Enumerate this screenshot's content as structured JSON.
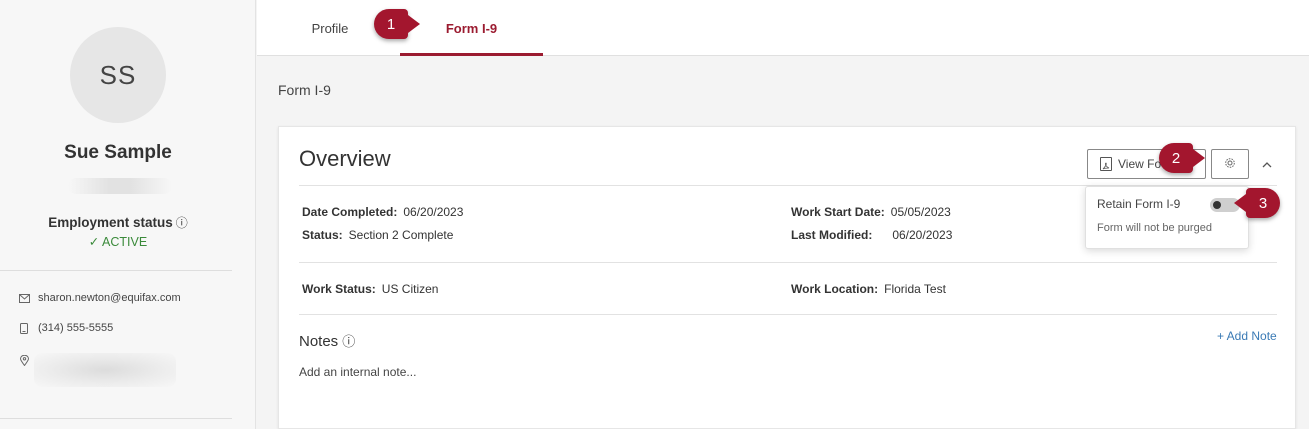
{
  "sidebar": {
    "avatar_initials": "SS",
    "name": "Sue Sample",
    "employment_status_label": "Employment status",
    "employment_status_info": "ⓘ",
    "employment_status_value": "✓ ACTIVE",
    "email": "sharon.newton@equifax.com",
    "phone": "(314) 555-5555"
  },
  "tabs": [
    {
      "label": "Profile"
    },
    {
      "label": "Form I-9"
    }
  ],
  "callouts": [
    "1",
    "2",
    "3"
  ],
  "page_heading": "Form I-9",
  "overview": {
    "title": "Overview",
    "view_form_label": "View Fo",
    "date_completed_label": "Date Completed:",
    "date_completed": "06/20/2023",
    "status_label": "Status:",
    "status": "Section 2 Complete",
    "work_start_label": "Work Start Date:",
    "work_start": "05/05/2023",
    "last_modified_label": "Last Modified:",
    "last_modified": "06/20/2023",
    "work_status_label": "Work Status:",
    "work_status": "US Citizen",
    "work_location_label": "Work Location:",
    "work_location": "Florida Test"
  },
  "popover": {
    "retain_label": "Retain Form I-9",
    "note": "Form will not be purged"
  },
  "notes": {
    "title": "Notes",
    "info": "ⓘ",
    "add_label": "+ Add Note",
    "placeholder": "Add an internal note..."
  },
  "colors": {
    "accent": "#9b1b30",
    "callout": "#a3162e",
    "active_green": "#3a8a3a",
    "link_blue": "#3a7ab5"
  }
}
